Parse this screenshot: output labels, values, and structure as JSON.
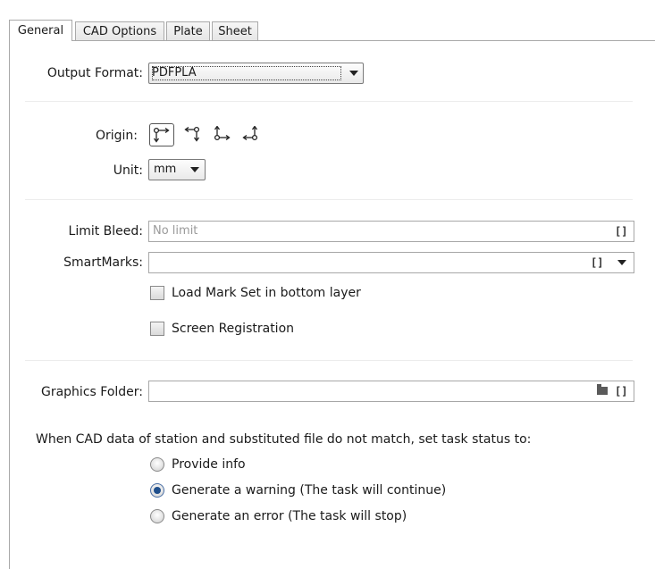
{
  "tabs": [
    "General",
    "CAD Options",
    "Plate",
    "Sheet"
  ],
  "output_format": {
    "label": "Output Format:",
    "value": "PDFPLA"
  },
  "origin": {
    "label": "Origin:"
  },
  "unit": {
    "label": "Unit:",
    "value": "mm"
  },
  "limit_bleed": {
    "label": "Limit Bleed:",
    "placeholder": "No limit",
    "value": ""
  },
  "smartmarks": {
    "label": "SmartMarks:",
    "value": ""
  },
  "checkboxes": [
    "Load Mark Set in bottom layer",
    "Screen Registration"
  ],
  "graphics_folder": {
    "label": "Graphics Folder:",
    "value": ""
  },
  "mismatch": {
    "prompt": "When CAD data of station and substituted file do not match, set task status to:",
    "options": [
      "Provide info",
      "Generate a warning (The task will continue)",
      "Generate an error (The task will stop)"
    ],
    "selected": "Generate a warning (The task will continue)"
  },
  "bracket_symbol": "[]",
  "icons": [
    "origin-top-left-icon",
    "origin-top-right-icon",
    "origin-bottom-left-icon",
    "origin-bottom-right-icon",
    "folder-icon",
    "dropdown-arrow-icon"
  ]
}
